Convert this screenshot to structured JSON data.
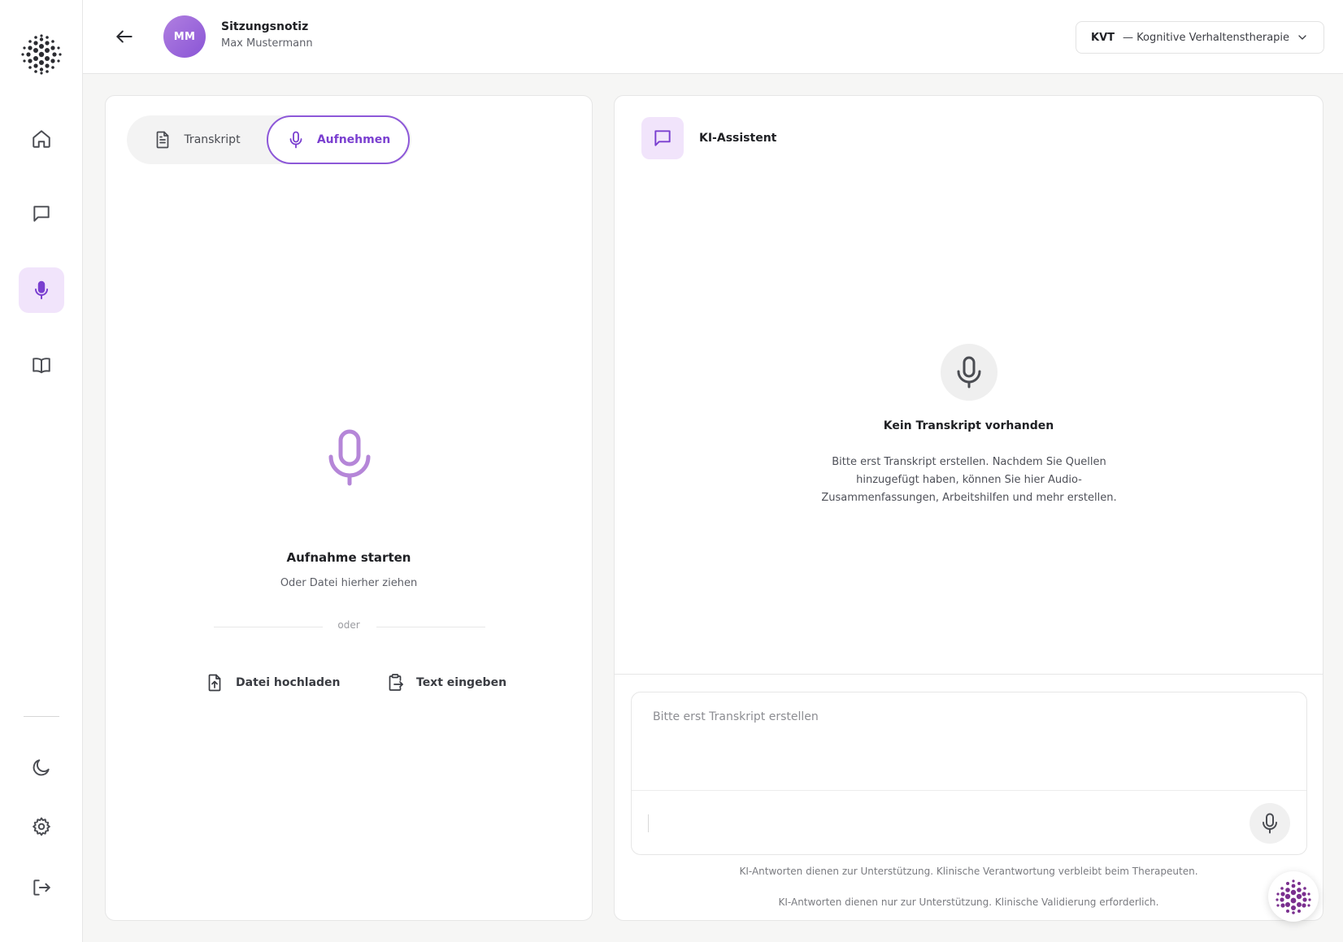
{
  "header": {
    "avatar_initials": "MM",
    "title": "Sitzungsnotiz",
    "subtitle": "Max Mustermann",
    "therapy_abbr": "KVT",
    "therapy_full": "— Kognitive Verhaltenstherapie"
  },
  "sidebar": {
    "nav": [
      {
        "icon": "home-icon"
      },
      {
        "icon": "chat-icon"
      },
      {
        "icon": "microphone-icon",
        "active": true
      },
      {
        "icon": "book-icon"
      }
    ],
    "bottom": [
      {
        "icon": "moon-icon"
      },
      {
        "icon": "gear-icon"
      },
      {
        "icon": "logout-icon"
      }
    ]
  },
  "left_panel": {
    "tabs": [
      {
        "label": "Transkript",
        "icon": "document-icon"
      },
      {
        "label": "Aufnehmen",
        "icon": "microphone-icon",
        "active": true
      }
    ],
    "start_title": "Aufnahme starten",
    "start_subtitle": "Oder Datei hierher ziehen",
    "or_text": "oder",
    "actions": [
      {
        "label": "Datei hochladen",
        "icon": "file-upload-icon"
      },
      {
        "label": "Text eingeben",
        "icon": "clipboard-icon"
      }
    ]
  },
  "right_panel": {
    "title": "KI-Assistent",
    "empty_title": "Kein Transkript vorhanden",
    "empty_description": "Bitte erst Transkript erstellen. Nachdem Sie Quellen hinzugefügt haben, können Sie hier Audio-Zusammenfassungen, Arbeitshilfen und mehr erstellen.",
    "chat_placeholder": "Bitte erst Transkript erstellen",
    "disclaimer_1": "KI-Antworten dienen zur Unterstützung. Klinische Verantwortung verbleibt beim Therapeuten.",
    "disclaimer_2": "KI-Antworten dienen nur zur Unterstützung. Klinische Validierung erforderlich."
  },
  "colors": {
    "accent": "#8d58d8",
    "accent_light": "#f1e4fb",
    "mic_purple": "#b586d8"
  }
}
